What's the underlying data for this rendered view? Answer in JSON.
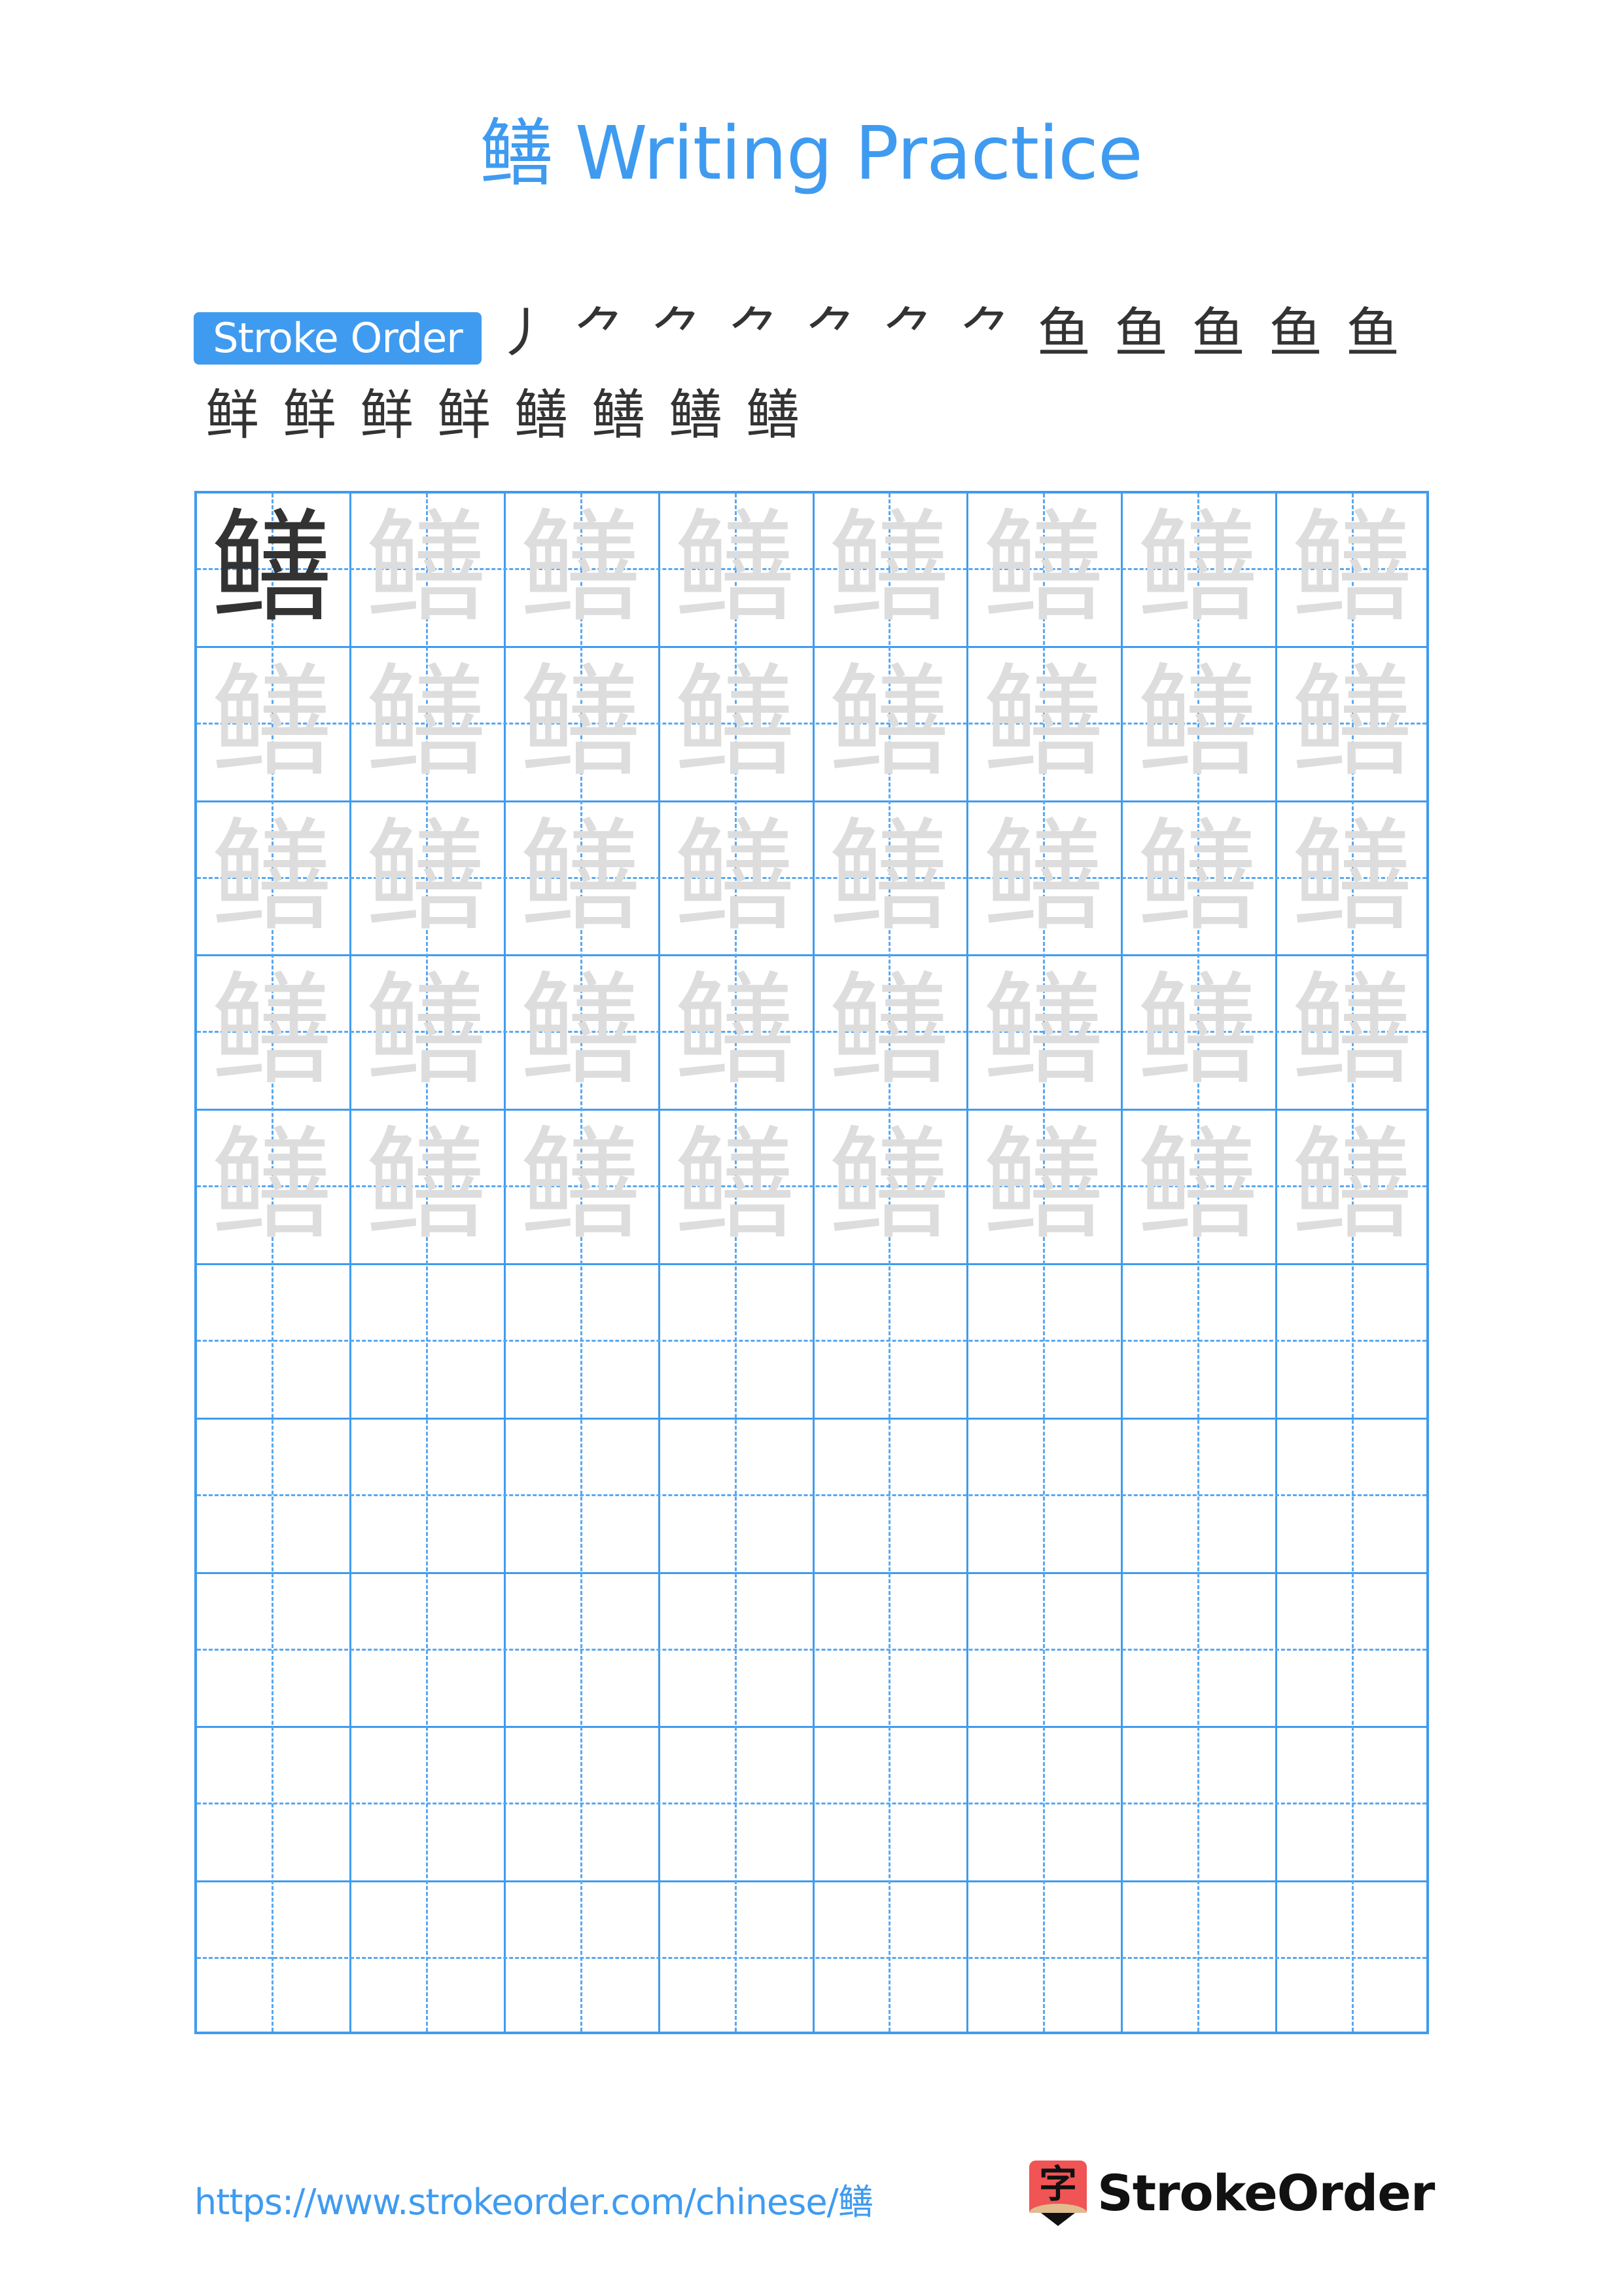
{
  "page": {
    "character": "鳝",
    "title": "鳝 Writing Practice"
  },
  "stroke_order": {
    "label": "Stroke Order",
    "total_strokes": 20,
    "frames": [
      {
        "step": 1,
        "glyph": "丿"
      },
      {
        "step": 2,
        "glyph": "⺈"
      },
      {
        "step": 3,
        "glyph": "⺈"
      },
      {
        "step": 4,
        "glyph": "⺈"
      },
      {
        "step": 5,
        "glyph": "⺈"
      },
      {
        "step": 6,
        "glyph": "⺈"
      },
      {
        "step": 7,
        "glyph": "⺈"
      },
      {
        "step": 8,
        "glyph": "鱼"
      },
      {
        "step": 9,
        "glyph": "鱼"
      },
      {
        "step": 10,
        "glyph": "鱼"
      },
      {
        "step": 11,
        "glyph": "鱼"
      },
      {
        "step": 12,
        "glyph": "鱼"
      },
      {
        "step": 13,
        "glyph": "鲜"
      },
      {
        "step": 14,
        "glyph": "鲜"
      },
      {
        "step": 15,
        "glyph": "鲜"
      },
      {
        "step": 16,
        "glyph": "鲜"
      },
      {
        "step": 17,
        "glyph": "鳝"
      },
      {
        "step": 18,
        "glyph": "鳝"
      },
      {
        "step": 19,
        "glyph": "鳝"
      },
      {
        "step": 20,
        "glyph": "鳝"
      }
    ],
    "current_stroke_color": "#FF0000",
    "done_stroke_color": "#333333"
  },
  "grid": {
    "columns": 8,
    "rows": 10,
    "model_cells": 1,
    "trace_rows": 5,
    "blank_rows": 5,
    "line_color": "#3F9BF0",
    "model_color": "#333333",
    "trace_color": "#DDDDDD"
  },
  "footer": {
    "url": "https://www.strokeorder.com/chinese/鳝",
    "logo_icon_char": "字",
    "brand": "StrokeOrder"
  }
}
